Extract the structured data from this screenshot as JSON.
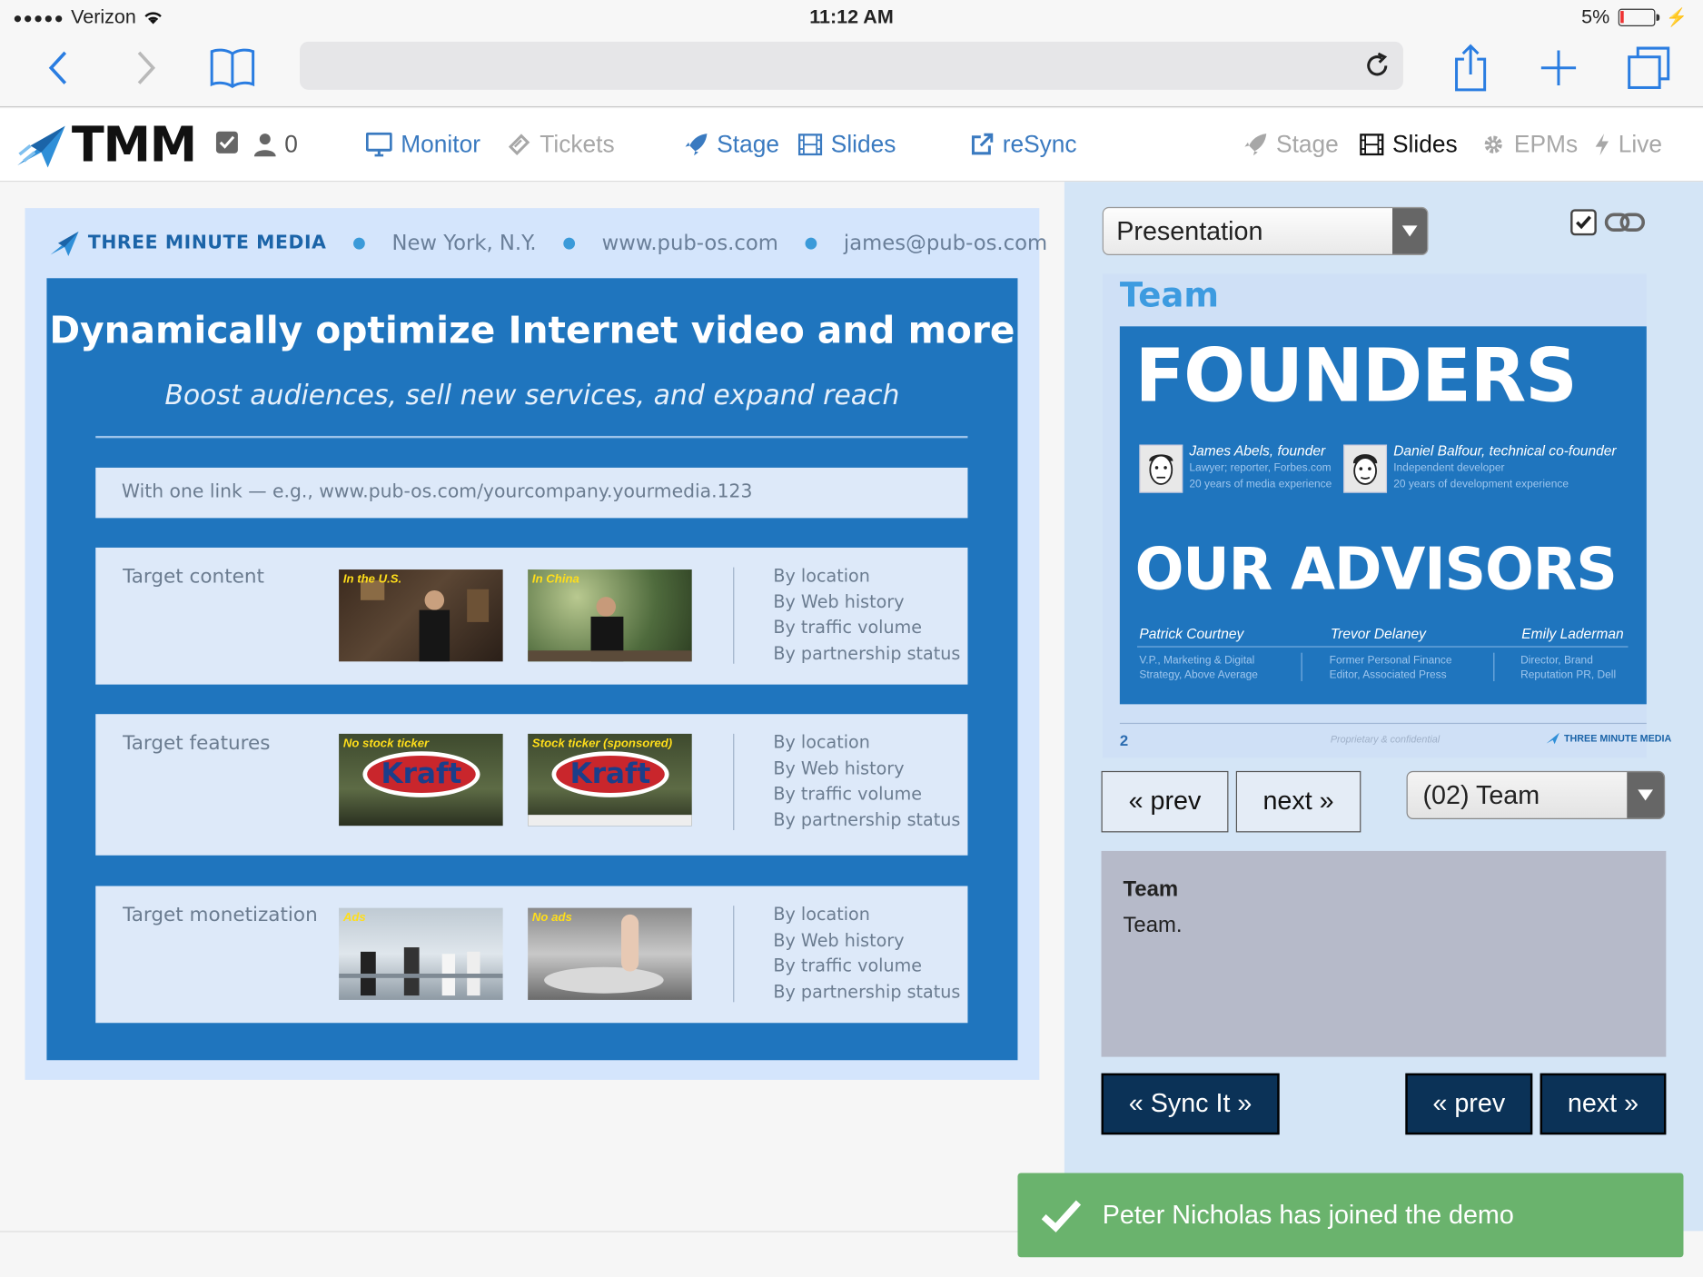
{
  "status": {
    "carrier": "Verizon",
    "time": "11:12 AM",
    "battery": "5%"
  },
  "app": {
    "logo": "TMM",
    "user_count": "0"
  },
  "nav": {
    "monitor": "Monitor",
    "tickets": "Tickets",
    "stage": "Stage",
    "slides": "Slides",
    "resync": "reSync",
    "right_stage": "Stage",
    "right_slides": "Slides",
    "epms": "EPMs",
    "live": "Live"
  },
  "slide": {
    "brand": "THREE MINUTE MEDIA",
    "location": "New York, N.Y.",
    "website": "www.pub-os.com",
    "email": "james@pub-os.com",
    "title": "Dynamically optimize Internet video and more",
    "subtitle": "Boost audiences, sell new services, and expand reach",
    "link_example": "With one link — e.g., www.pub-os.com/yourcompany.yourmedia.123",
    "rows": [
      {
        "label": "Target content",
        "thumb1_tag": "In the U.S.",
        "thumb2_tag": "In China",
        "list": [
          "By location",
          "By Web history",
          "By traffic volume",
          "By partnership status"
        ]
      },
      {
        "label": "Target features",
        "thumb1_tag": "No stock ticker",
        "thumb2_tag": "Stock ticker (sponsored)",
        "thumb_brand": "Kraft",
        "list": [
          "By location",
          "By Web history",
          "By traffic volume",
          "By partnership status"
        ]
      },
      {
        "label": "Target monetization",
        "thumb1_tag": "Ads",
        "thumb2_tag": "No ads",
        "list": [
          "By location",
          "By Web history",
          "By traffic volume",
          "By partnership status"
        ]
      }
    ]
  },
  "panel": {
    "presentation_select": "Presentation",
    "preview": {
      "section": "Team",
      "founders": "FOUNDERS",
      "founder1_name": "James Abels, founder",
      "founder1_l1": "Lawyer; reporter, Forbes.com",
      "founder1_l2": "20 years of media experience",
      "founder2_name": "Daniel Balfour, technical co-founder",
      "founder2_l1": "Independent developer",
      "founder2_l2": "20 years of development experience",
      "advisors": "OUR ADVISORS",
      "advisor1_name": "Patrick Courtney",
      "advisor1_l1": "V.P., Marketing & Digital",
      "advisor1_l2": "Strategy, Above Average",
      "advisor2_name": "Trevor Delaney",
      "advisor2_l1": "Former Personal Finance",
      "advisor2_l2": "Editor, Associated Press",
      "advisor3_name": "Emily Laderman",
      "advisor3_l1": "Director, Brand",
      "advisor3_l2": "Reputation PR, Dell",
      "page_number": "2",
      "confidential": "Proprietary & confidential",
      "footer_brand": "THREE MINUTE MEDIA"
    },
    "prev_label": "« prev",
    "next_label": "next »",
    "slide_select": "(02) Team",
    "notes_title": "Team",
    "notes_text": "Team.",
    "sync_label": "« Sync It »",
    "prev2_label": "« prev",
    "next2_label": "next »"
  },
  "toast": {
    "message": "Peter Nicholas has joined the demo"
  },
  "colors": {
    "accent": "#1f75be",
    "nav_link": "#3a7ac0",
    "toast": "#6ab36d",
    "dark_button": "#0b3257"
  }
}
